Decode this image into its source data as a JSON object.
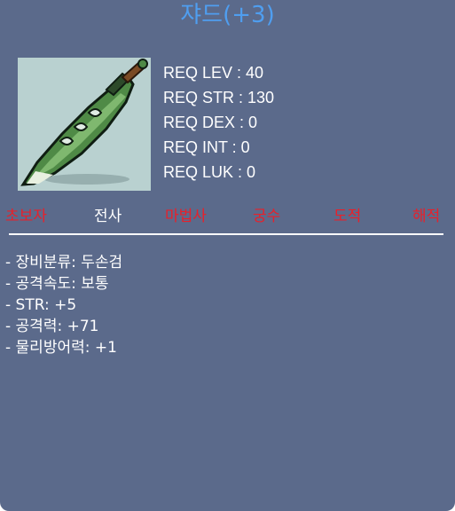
{
  "item": {
    "name": "쟈드(+3)",
    "icon": "green-serrated-sword-icon"
  },
  "requirements": [
    {
      "text": "REQ LEV : 40"
    },
    {
      "text": "REQ STR : 130"
    },
    {
      "text": "REQ DEX : 0"
    },
    {
      "text": "REQ INT : 0"
    },
    {
      "text": "REQ LUK : 0"
    }
  ],
  "jobs": [
    {
      "label": "초보자",
      "available": false
    },
    {
      "label": "전사",
      "available": true
    },
    {
      "label": "마법사",
      "available": false
    },
    {
      "label": "궁수",
      "available": false
    },
    {
      "label": "도적",
      "available": false
    },
    {
      "label": "해적",
      "available": false
    }
  ],
  "stats": [
    {
      "text": "- 장비분류: 두손검"
    },
    {
      "text": "- 공격속도: 보통"
    },
    {
      "text": "- STR: +5"
    },
    {
      "text": "- 공격력: +71"
    },
    {
      "text": "- 물리방어력: +1"
    }
  ],
  "colors": {
    "panel": "#5b6a8b",
    "title": "#4f9ef0",
    "job_unavailable": "#e8202a",
    "job_available": "#ffffff"
  }
}
